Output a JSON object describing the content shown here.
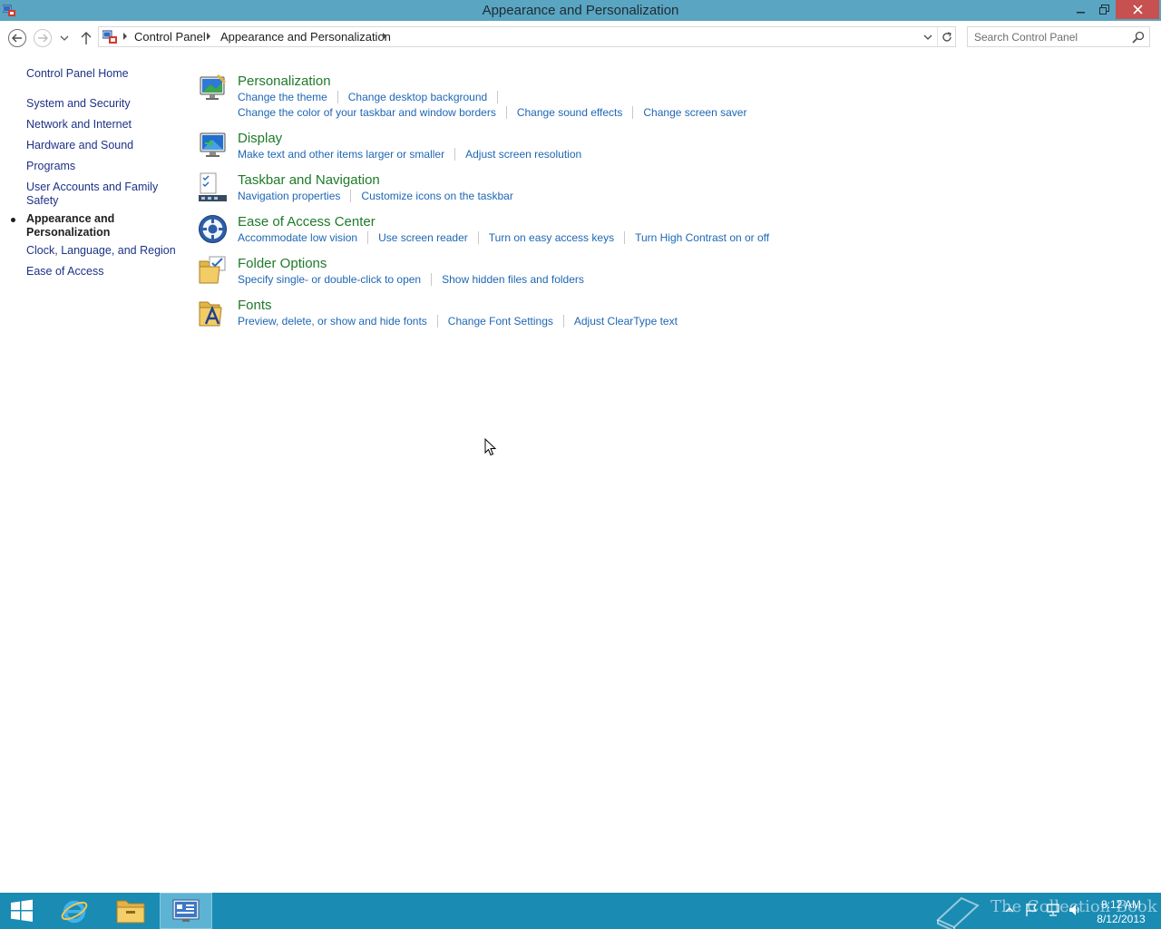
{
  "window": {
    "title": "Appearance and Personalization"
  },
  "address": {
    "crumbs": [
      "Control Panel",
      "Appearance and Personalization"
    ]
  },
  "search": {
    "placeholder": "Search Control Panel"
  },
  "sidebar": {
    "home": "Control Panel Home",
    "items": [
      {
        "label": "System and Security"
      },
      {
        "label": "Network and Internet"
      },
      {
        "label": "Hardware and Sound"
      },
      {
        "label": "Programs"
      },
      {
        "label": "User Accounts and Family",
        "label2": "Safety"
      },
      {
        "label": "Appearance and",
        "label2": "Personalization",
        "current": true
      },
      {
        "label": "Clock, Language, and Region"
      },
      {
        "label": "Ease of Access"
      }
    ]
  },
  "categories": [
    {
      "title": "Personalization",
      "icon": "personalization-icon",
      "links_row1": [
        "Change the theme",
        "Change desktop background"
      ],
      "links_row2": [
        "Change the color of your taskbar and window borders",
        "Change sound effects",
        "Change screen saver"
      ]
    },
    {
      "title": "Display",
      "icon": "display-icon",
      "links_row1": [
        "Make text and other items larger or smaller",
        "Adjust screen resolution"
      ]
    },
    {
      "title": "Taskbar and Navigation",
      "icon": "taskbar-icon",
      "links_row1": [
        "Navigation properties",
        "Customize icons on the taskbar"
      ]
    },
    {
      "title": "Ease of Access Center",
      "icon": "ease-of-access-icon",
      "links_row1": [
        "Accommodate low vision",
        "Use screen reader",
        "Turn on easy access keys",
        "Turn High Contrast on or off"
      ]
    },
    {
      "title": "Folder Options",
      "icon": "folder-options-icon",
      "links_row1": [
        "Specify single- or double-click to open",
        "Show hidden files and folders"
      ]
    },
    {
      "title": "Fonts",
      "icon": "fonts-icon",
      "links_row1": [
        "Preview, delete, or show and hide fonts",
        "Change Font Settings",
        "Adjust ClearType text"
      ]
    }
  ],
  "taskbar": {
    "watermark": "The Collection Book",
    "time": "8:12 AM",
    "date": "8/12/2013"
  },
  "colors": {
    "titlebar": "#5aa5c1",
    "taskbar": "#1a8bb3",
    "link": "#1e66b4",
    "category_title": "#1e7a29",
    "close_button": "#c75050"
  }
}
